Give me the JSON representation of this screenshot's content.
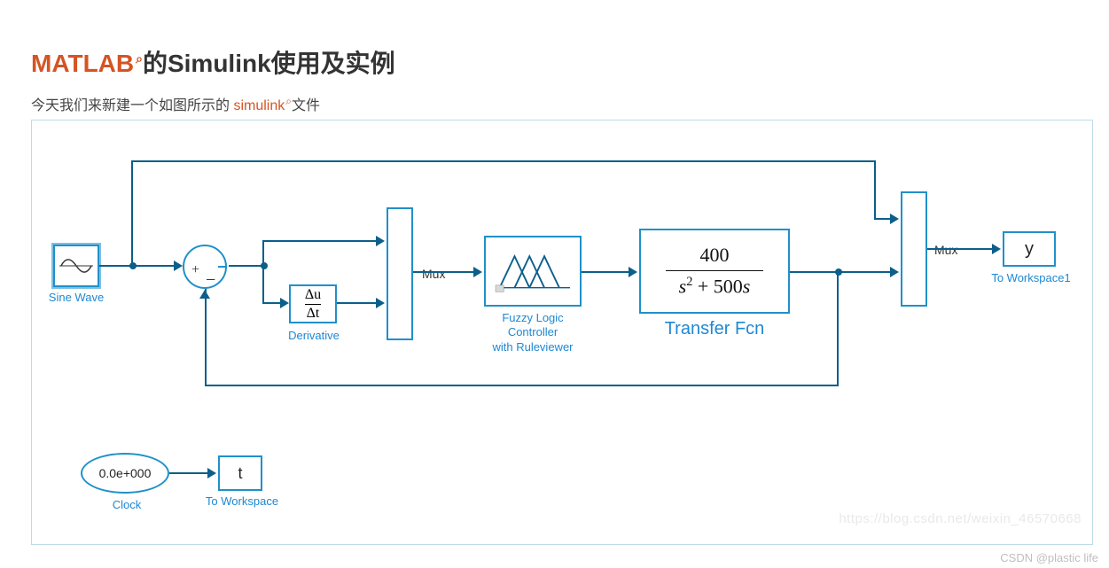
{
  "title": {
    "highlight": "MATLAB",
    "rest": "的Simulink使用及实例"
  },
  "subtitle": {
    "prefix": "今天我们来新建一个如图所示的",
    "highlight": "simulink",
    "suffix": "文件"
  },
  "watermark": {
    "url": "https://blog.csdn.net/weixin_46570668",
    "author": "CSDN @plastic life"
  },
  "blocks": {
    "sine_wave": {
      "label": "Sine Wave"
    },
    "sum": {
      "signs": "+−"
    },
    "derivative": {
      "top": "Δu",
      "bottom": "Δt",
      "label": "Derivative"
    },
    "mux1": {
      "label": "Mux"
    },
    "fuzzy": {
      "label": "Fuzzy Logic\nController\nwith Ruleviewer"
    },
    "transfer_fcn": {
      "numerator": "400",
      "denominator_tex": "s² + 500s",
      "label": "Transfer Fcn"
    },
    "mux2": {
      "label": "Mux"
    },
    "to_workspace1": {
      "var": "y",
      "label": "To Workspace1"
    },
    "clock": {
      "display": "0.0e+000",
      "label": "Clock"
    },
    "to_workspace": {
      "var": "t",
      "label": "To Workspace"
    }
  }
}
